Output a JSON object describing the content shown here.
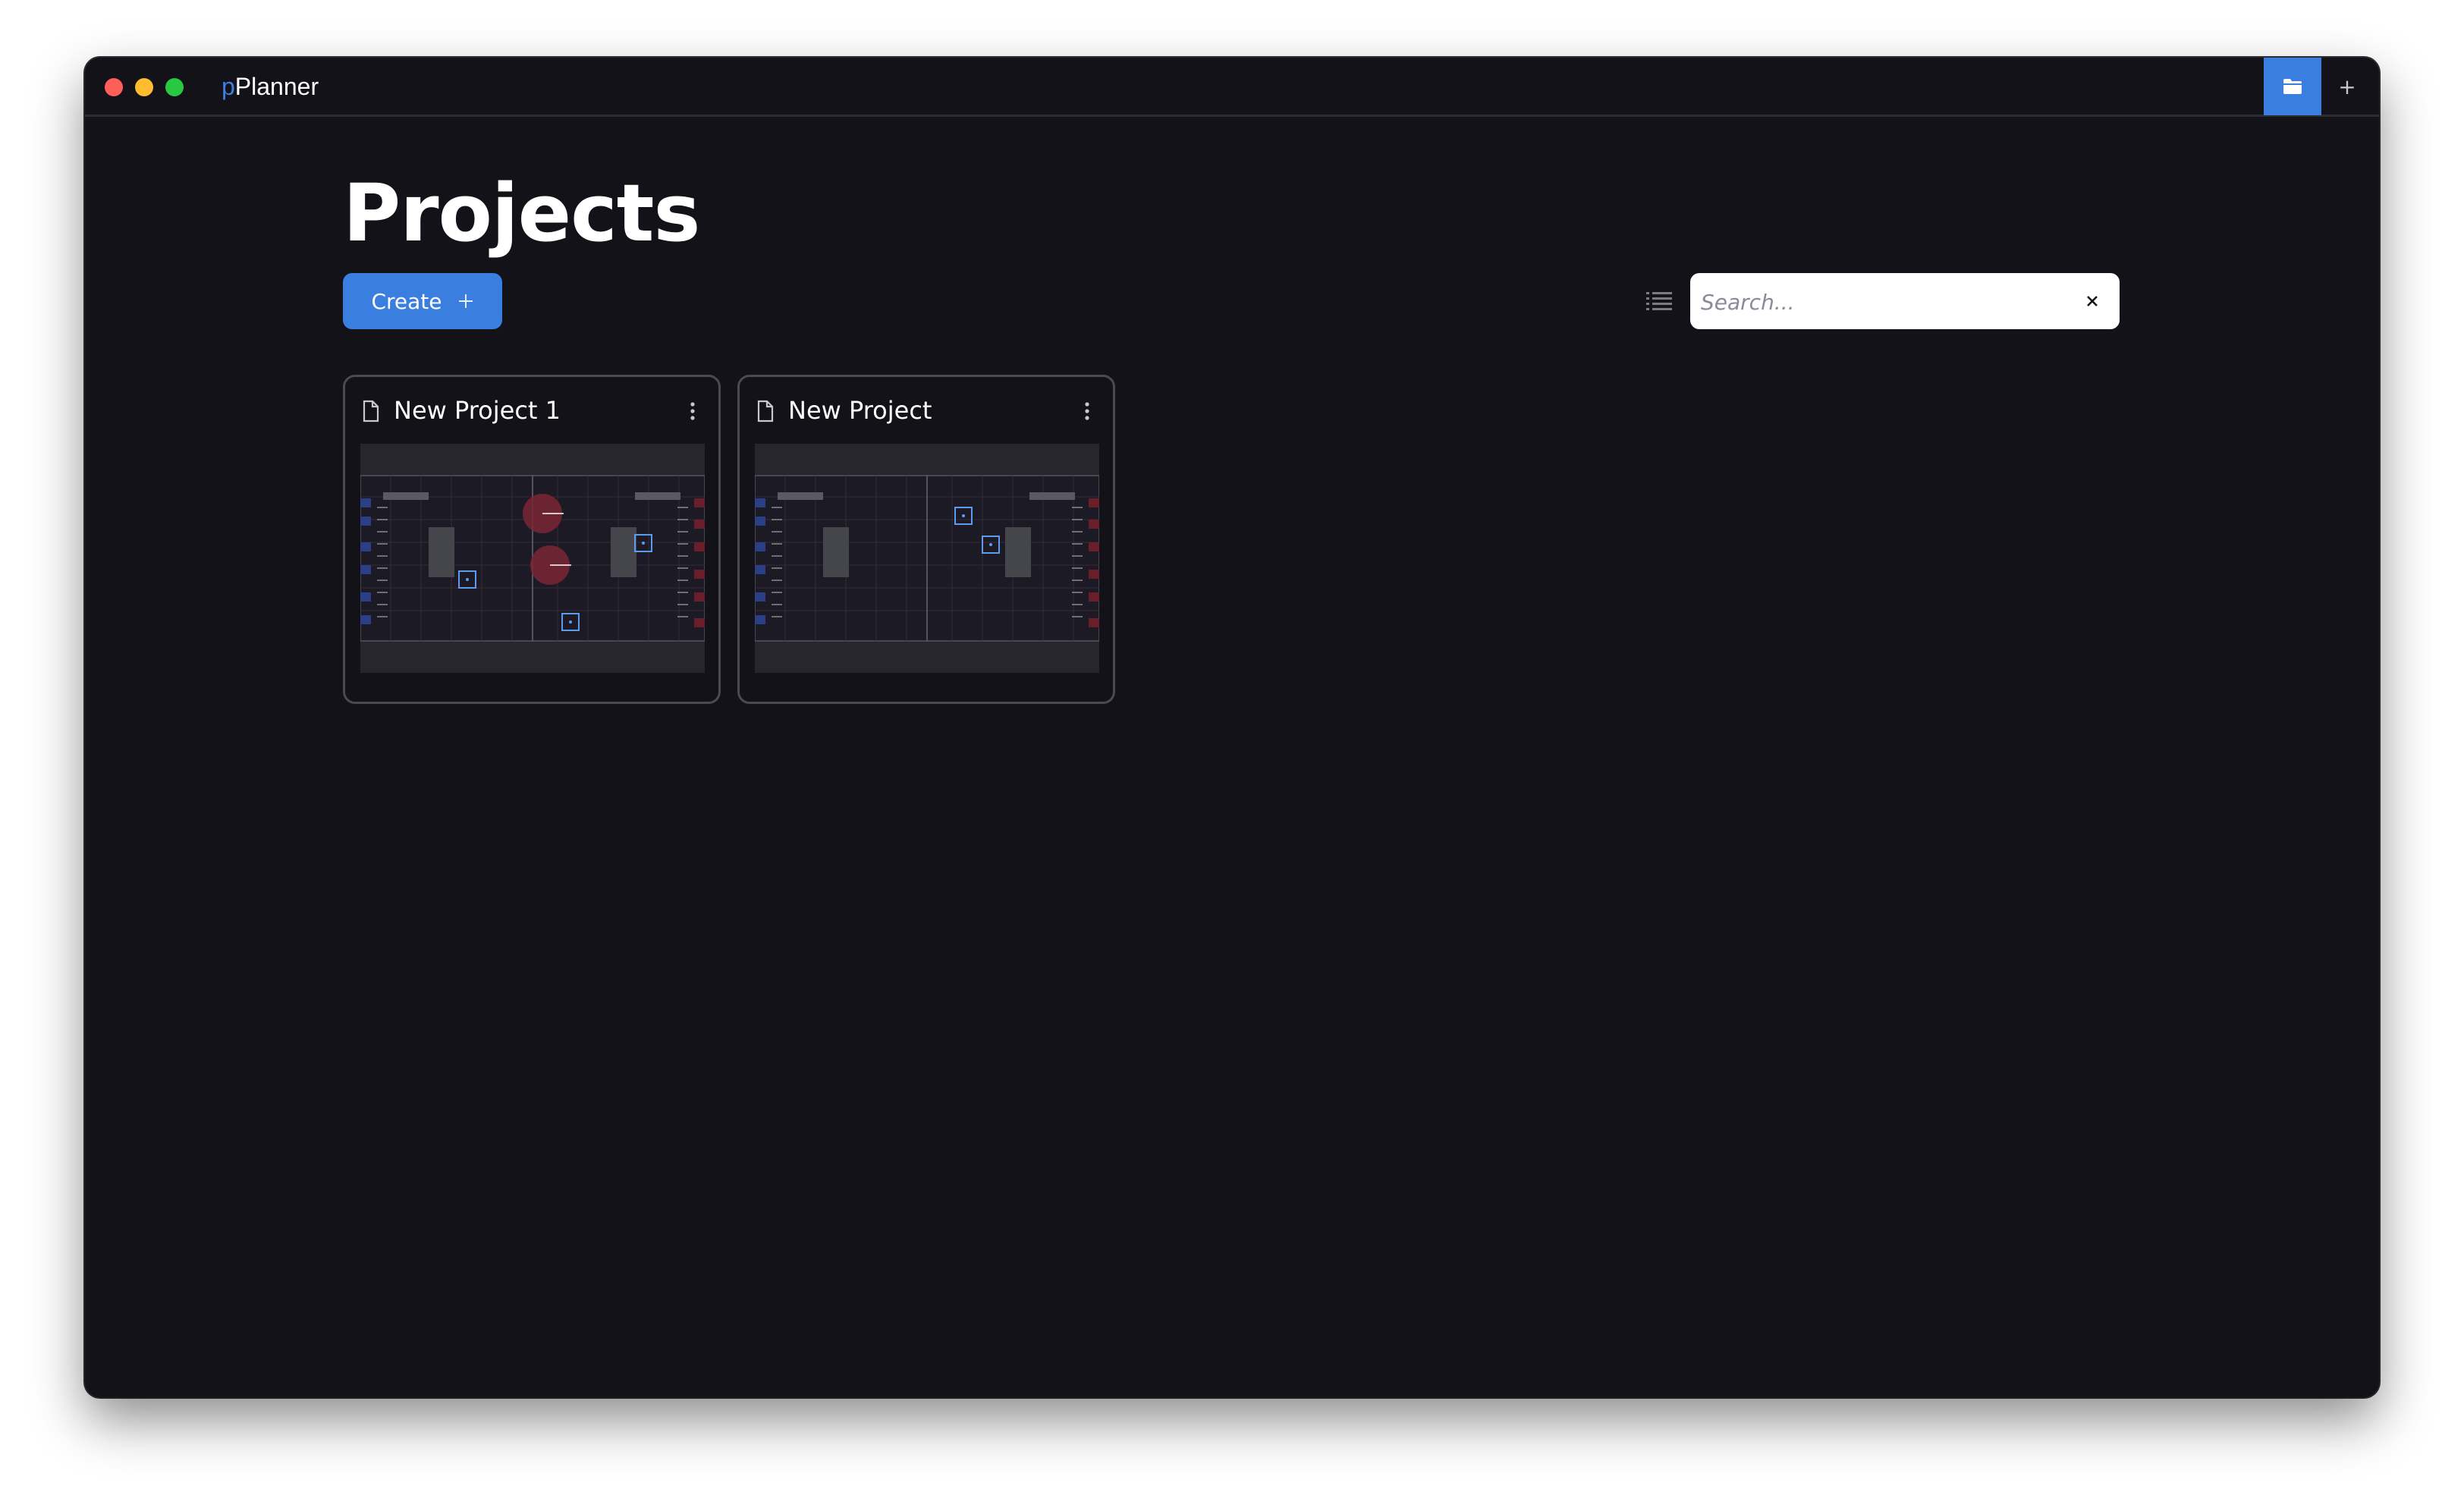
{
  "app": {
    "brand_letter": "p",
    "brand_rest": "Planner",
    "colors": {
      "accent": "#3a7ee0",
      "background": "#121218"
    }
  },
  "titlebar": {
    "folder_tab_icon": "folder-icon",
    "new_tab_label": "+"
  },
  "page": {
    "title": "Projects"
  },
  "toolbar": {
    "create_label": "Create",
    "create_icon": "plus-icon",
    "view_toggle_icon": "list-icon",
    "search_placeholder": "Search...",
    "search_value": "",
    "search_clear_icon": "close-icon"
  },
  "projects": [
    {
      "name": "New Project 1",
      "icon": "file-icon",
      "menu_icon": "more-vertical-icon"
    },
    {
      "name": "New Project",
      "icon": "file-icon",
      "menu_icon": "more-vertical-icon"
    }
  ]
}
